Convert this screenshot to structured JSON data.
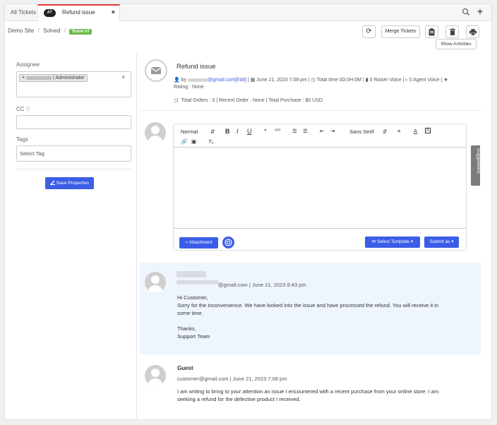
{
  "tabs": {
    "all_label": "All Tickets",
    "active": {
      "badge": "#7",
      "title": "Refund issue",
      "close": "×"
    },
    "plus": "+"
  },
  "breadcrumb": {
    "site": "Demo Site",
    "sep": "/",
    "status": "Solved",
    "ticket_badge": "Ticket #7"
  },
  "toolbar": {
    "refresh": "⟳",
    "merge": "Merge Tickets",
    "show_activities": "Show Activities"
  },
  "properties": {
    "assignee_label": "Assignee",
    "assignee_chip_prefix": "×",
    "assignee_chip_text": "| Administrator",
    "assignee_clear": "×",
    "cc_label": "CC",
    "cc_info": "ⓘ",
    "tags_label": "Tags",
    "tags_placeholder": "Select Tag",
    "save_label": "Save Properties"
  },
  "ticket": {
    "subject": "Refund issue",
    "by": "by",
    "email_domain": "@gmail.com",
    "edit": "[Edit]",
    "date": "June 21, 2023 7:08 pm",
    "total_time": "Total time 0D:0H:0M",
    "raiser_voice": "0 Raiser Voice",
    "agent_voice": "0 Agent Voice",
    "rating": "Rating : None",
    "orders": "Total Orders : 0 | Recent Order : None | Total Purchase : $0 USD"
  },
  "editor": {
    "format": "Normal",
    "font": "Sans Serif",
    "attachment": "Attachment",
    "select_template": "Select Template",
    "submit": "Submit as",
    "suggestions": "Suggestions"
  },
  "threads": [
    {
      "meta": "@gmail.com | June 21, 2023 8:43 pm",
      "body": "Hi Customer,\nSorry for the inconvenience. We have looked into the issue and have processed the refund. You will receive it in\nsome time.\n\nThanks,\nSupport Team"
    },
    {
      "name": "Guest",
      "meta": "customer@gmail.com | June 21, 2023 7:08 pm",
      "body": "I am writing to bring to your attention an issue I encountered with a recent purchase from your online store. I am\nseeking a refund for the defective product I received."
    }
  ],
  "colors": {
    "primary": "#3b5de7",
    "success": "#6cb84a",
    "tab_accent": "#e23c3c"
  }
}
